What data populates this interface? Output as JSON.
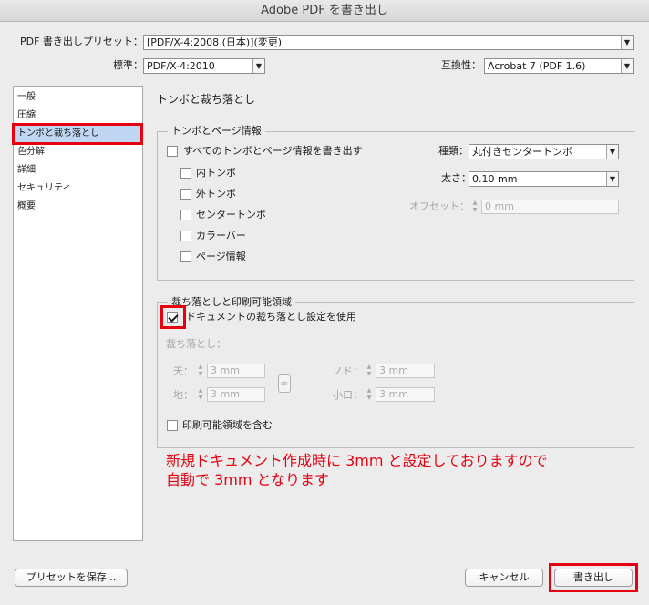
{
  "window": {
    "title": "Adobe PDF を書き出し"
  },
  "header": {
    "preset_label": "PDF 書き出しプリセット：",
    "preset_value": "[PDF/X-4:2008 (日本)](変更)",
    "standard_label": "標準：",
    "standard_value": "PDF/X-4:2010",
    "compat_label": "互換性：",
    "compat_value": "Acrobat 7 (PDF 1.6)"
  },
  "sidebar": {
    "items": [
      {
        "label": "一般"
      },
      {
        "label": "圧縮"
      },
      {
        "label": "トンボと裁ち落とし"
      },
      {
        "label": "色分解"
      },
      {
        "label": "詳細"
      },
      {
        "label": "セキュリティ"
      },
      {
        "label": "概要"
      }
    ]
  },
  "main": {
    "section_title": "トンボと裁ち落とし",
    "marks": {
      "legend": "トンボとページ情報",
      "all_marks": "すべてのトンボとページ情報を書き出す",
      "crop": "内トンボ",
      "bleed": "外トンボ",
      "registration": "センタートンボ",
      "color_bars": "カラーバー",
      "page_info": "ページ情報",
      "type_label": "種類：",
      "type_value": "丸付きセンタートンボ",
      "weight_label": "太さ：",
      "weight_value": "0.10 mm",
      "offset_label": "オフセット：",
      "offset_value": "0 mm"
    },
    "bleed": {
      "legend": "裁ち落としと印刷可能領域",
      "use_doc": "ドキュメントの裁ち落とし設定を使用",
      "bleed_label": "裁ち落とし：",
      "top_label": "天：",
      "top_value": "3 mm",
      "bottom_label": "地：",
      "bottom_value": "3 mm",
      "inside_label": "ノド：",
      "inside_value": "3 mm",
      "outside_label": "小口：",
      "outside_value": "3 mm",
      "slug": "印刷可能領域を含む"
    },
    "annotation": {
      "line1": "新規ドキュメント作成時に 3mm と設定しておりますので",
      "line2": "自動で 3mm となります"
    }
  },
  "footer": {
    "save_preset": "プリセットを保存...",
    "cancel": "キャンセル",
    "export": "書き出し"
  },
  "colors": {
    "highlight": "#e60012",
    "selection": "#bfd7f3"
  }
}
